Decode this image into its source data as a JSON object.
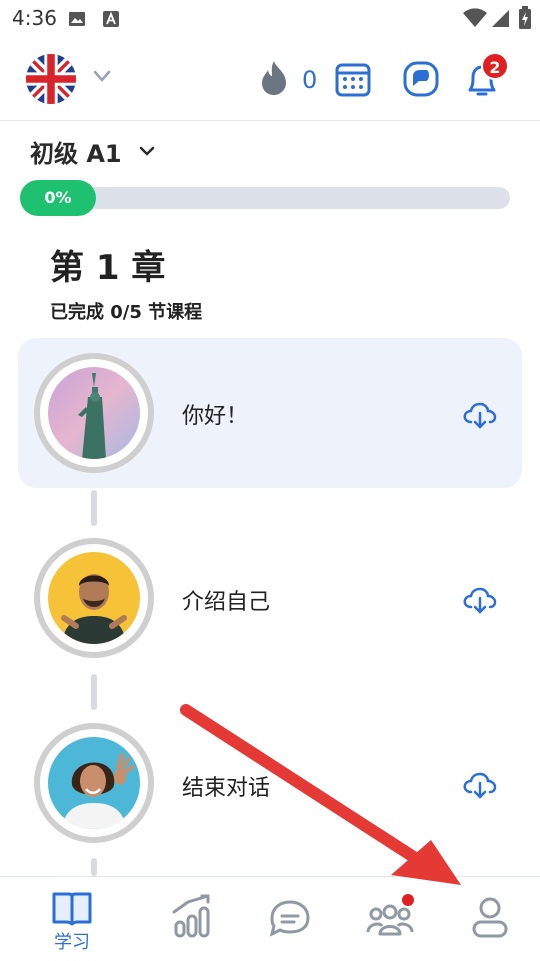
{
  "status_bar": {
    "time": "4:36"
  },
  "header": {
    "flag_icon": "uk-flag-icon",
    "streak_count": "0",
    "notification_badge": "2"
  },
  "level": {
    "label": "初级 A1",
    "progress_text": "0%",
    "progress_value": 0
  },
  "chapter": {
    "title": "第 1 章",
    "subtitle": "已完成 0/5 节课程"
  },
  "lessons": [
    {
      "title": "你好！",
      "image": "statue-of-liberty-photo"
    },
    {
      "title": "介绍自己",
      "image": "smiling-man-photo"
    },
    {
      "title": "结束对话",
      "image": "waving-woman-photo"
    }
  ],
  "bottom_nav": {
    "learn_label": "学习"
  },
  "colors": {
    "accent_blue": "#2b6fd6",
    "progress_green": "#1ec16f",
    "badge_red": "#e02020",
    "annotation_arrow": "#e53935"
  }
}
